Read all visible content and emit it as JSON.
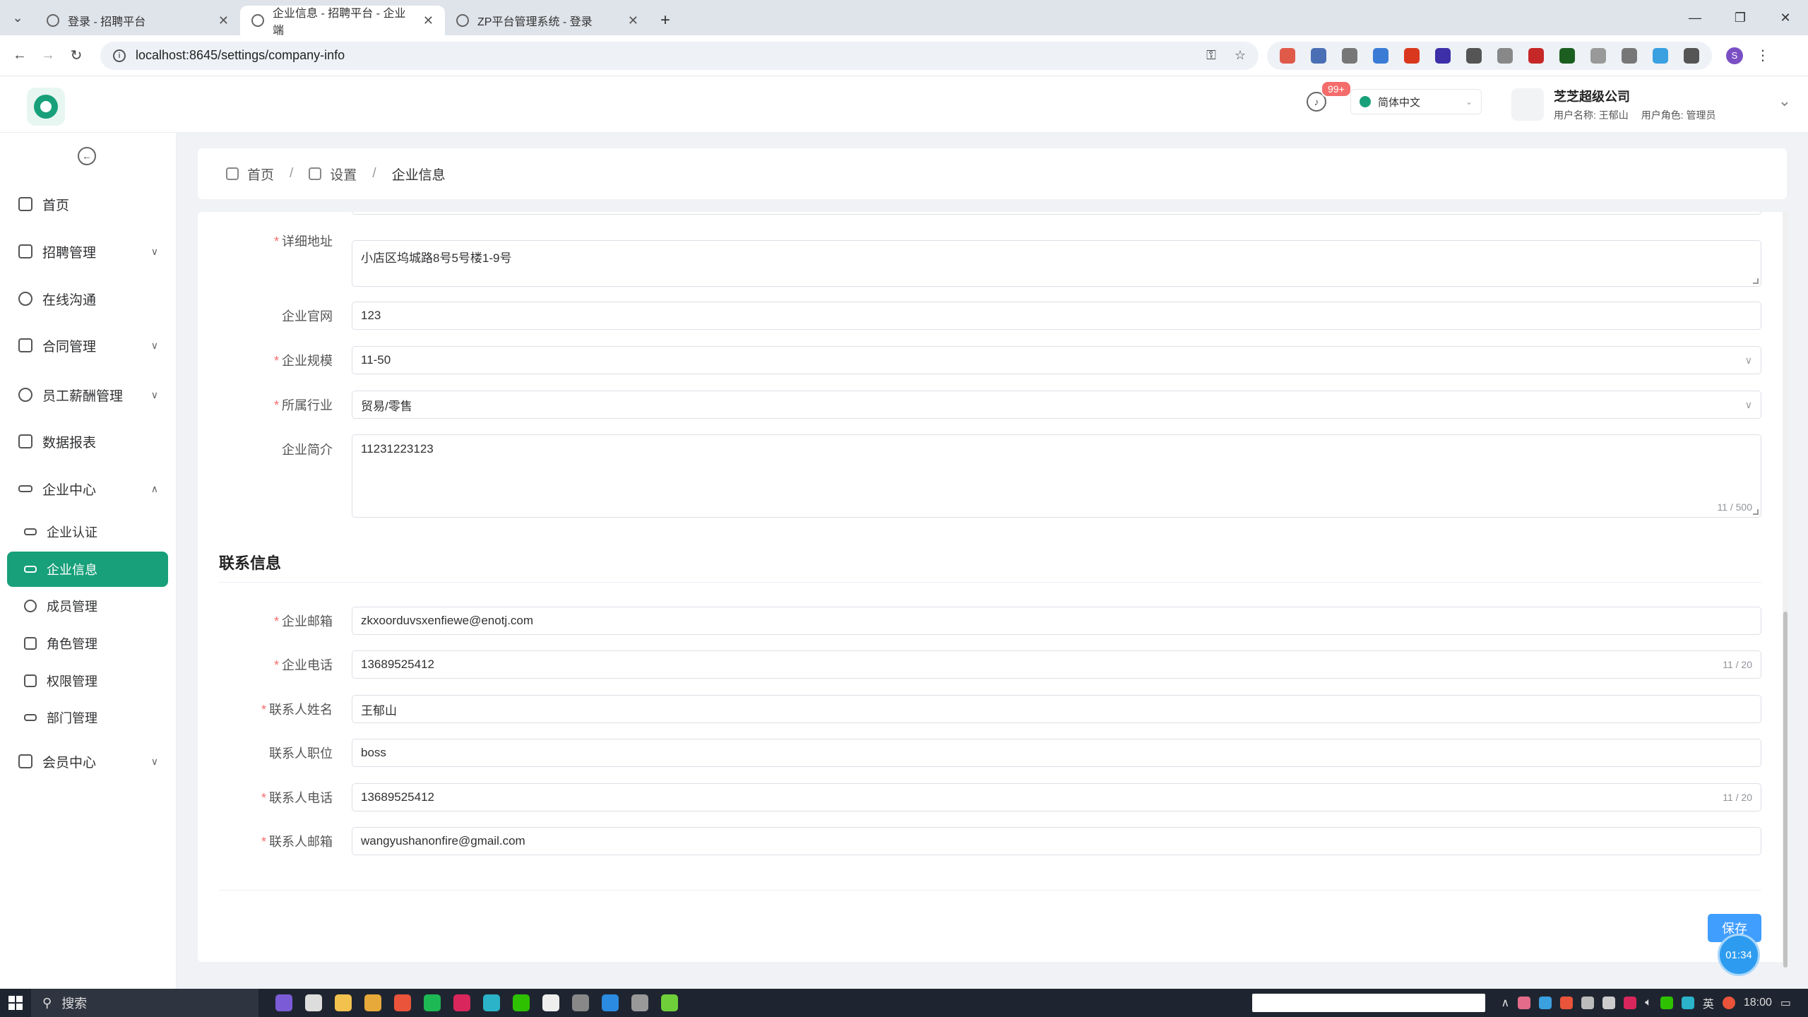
{
  "browser": {
    "tabs": [
      {
        "title": "登录 - 招聘平台",
        "active": false
      },
      {
        "title": "企业信息 - 招聘平台 - 企业端",
        "active": true
      },
      {
        "title": "ZP平台管理系统 - 登录",
        "active": false
      }
    ],
    "url": "localhost:8645/settings/company-info"
  },
  "header": {
    "notification_count": "99+",
    "language": "简体中文",
    "company_name": "芝芝超级公司",
    "user_label": "用户名称:",
    "user_name": "王郁山",
    "role_label": "用户角色:",
    "role_name": "管理员"
  },
  "sidebar": {
    "items": [
      {
        "label": "首页",
        "icon": "document-icon"
      },
      {
        "label": "招聘管理",
        "icon": "list-icon"
      },
      {
        "label": "在线沟通",
        "icon": "chat-icon"
      },
      {
        "label": "合同管理",
        "icon": "grid-icon"
      },
      {
        "label": "员工薪酬管理",
        "icon": "yen-icon"
      },
      {
        "label": "数据报表",
        "icon": "report-icon"
      },
      {
        "label": "企业中心",
        "icon": "card-icon"
      },
      {
        "label": "会员中心",
        "icon": "thumb-icon"
      }
    ],
    "sub_items": [
      {
        "label": "企业认证",
        "icon": "id-card-icon"
      },
      {
        "label": "企业信息",
        "icon": "card-icon"
      },
      {
        "label": "成员管理",
        "icon": "user-icon"
      },
      {
        "label": "角色管理",
        "icon": "lock-icon"
      },
      {
        "label": "权限管理",
        "icon": "lock-icon"
      },
      {
        "label": "部门管理",
        "icon": "card-icon"
      }
    ]
  },
  "breadcrumb": {
    "home": "首页",
    "settings": "设置",
    "current": "企业信息"
  },
  "form": {
    "address_label": "详细地址",
    "address_value": "小店区坞城路8号5号楼1-9号",
    "website_label": "企业官网",
    "website_value": "123",
    "scale_label": "企业规模",
    "scale_value": "11-50",
    "industry_label": "所属行业",
    "industry_value": "贸易/零售",
    "intro_label": "企业简介",
    "intro_value": "11231223123",
    "intro_count": "11 / 500",
    "contact_section": "联系信息",
    "email_label": "企业邮箱",
    "email_value": "zkxoorduvsxenfiewe@enotj.com",
    "phone_label": "企业电话",
    "phone_value": "13689525412",
    "phone_count": "11 / 20",
    "contact_name_label": "联系人姓名",
    "contact_name_value": "王郁山",
    "contact_position_label": "联系人职位",
    "contact_position_value": "boss",
    "contact_phone_label": "联系人电话",
    "contact_phone_value": "13689525412",
    "contact_phone_count": "11 / 20",
    "contact_email_label": "联系人邮箱",
    "contact_email_value": "wangyushanonfire@gmail.com",
    "save_label": "保存"
  },
  "timer": "01:34",
  "taskbar": {
    "search_label": "搜索",
    "ime": "英",
    "time": "18:00"
  },
  "colors": {
    "primary": "#17a07a",
    "save_button": "#409eff",
    "required": "#f56c6c"
  }
}
